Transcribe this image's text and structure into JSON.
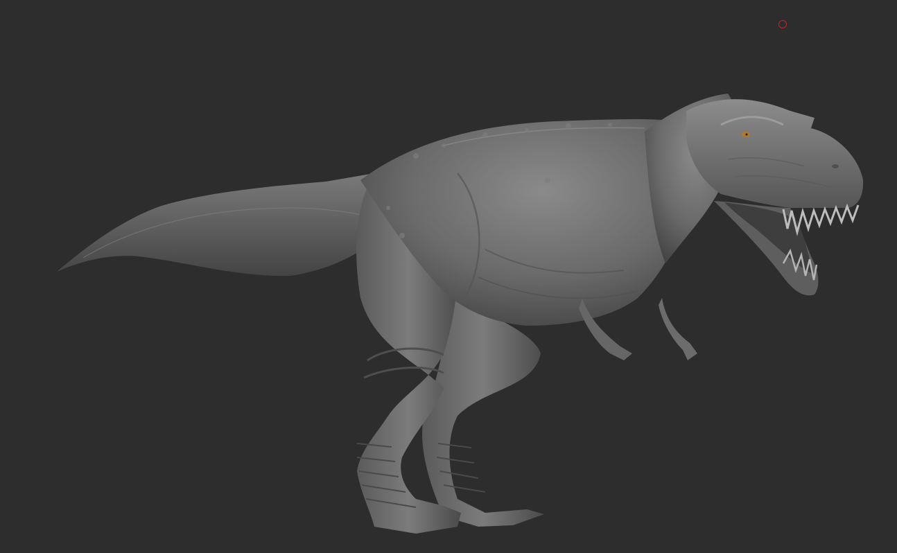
{
  "viewport": {
    "background_color": "#2d2d2d",
    "model_subject": "tyrannosaurus",
    "model_color": "#6e6e6e",
    "eye_color": "#b5772b",
    "cursor_icon": "brush-cursor-icon",
    "cursor_color": "#c4262b"
  }
}
